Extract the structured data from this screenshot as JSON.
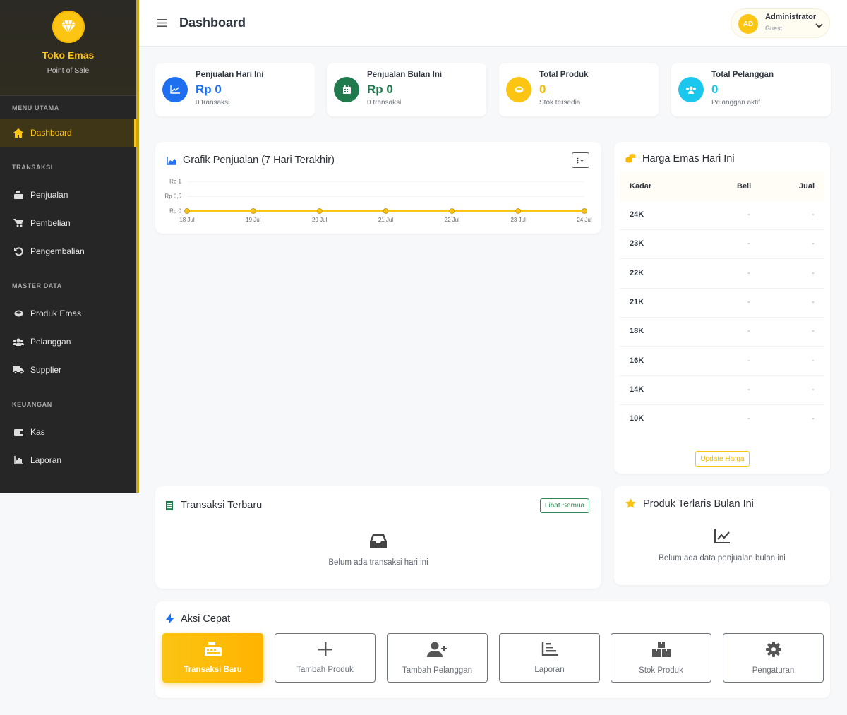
{
  "sidebar": {
    "brand": {
      "title": "Toko Emas",
      "subtitle": "Point of Sale"
    },
    "sections": {
      "main": "MENU UTAMA",
      "transaksi": "TRANSAKSI",
      "master": "MASTER DATA",
      "keuangan": "KEUANGAN"
    },
    "items": {
      "dashboard": "Dashboard",
      "penjualan": "Penjualan",
      "pembelian": "Pembelian",
      "pengembalian": "Pengembalian",
      "produk": "Produk Emas",
      "pelanggan": "Pelanggan",
      "supplier": "Supplier",
      "kas": "Kas",
      "laporan": "Laporan"
    }
  },
  "header": {
    "title": "Dashboard",
    "user": {
      "initials": "AD",
      "name": "Administrator",
      "role": "Guest"
    }
  },
  "stats": [
    {
      "title": "Penjualan Hari Ini",
      "value": "Rp 0",
      "sub": "0 transaksi",
      "color": "#1e6ff0"
    },
    {
      "title": "Penjualan Bulan Ini",
      "value": "Rp 0",
      "sub": "0 transaksi",
      "color": "#1f7a4d"
    },
    {
      "title": "Total Produk",
      "value": "0",
      "sub": "Stok tersedia",
      "color": "#fcc413"
    },
    {
      "title": "Total Pelanggan",
      "value": "0",
      "sub": "Pelanggan aktif",
      "color": "#1cc7ee"
    }
  ],
  "sales_chart": {
    "title": "Grafik Penjualan (7 Hari Terakhir)"
  },
  "chart_data": {
    "type": "line",
    "categories": [
      "18 Jul",
      "19 Jul",
      "20 Jul",
      "21 Jul",
      "22 Jul",
      "23 Jul",
      "24 Jul"
    ],
    "values": [
      0,
      0,
      0,
      0,
      0,
      0,
      0
    ],
    "y_ticks": [
      "Rp 0",
      "Rp 0,5",
      "Rp 1"
    ],
    "ylim": [
      0,
      1
    ],
    "grid": true,
    "color": "#fcc413"
  },
  "gold": {
    "title": "Harga Emas Hari Ini",
    "headers": {
      "kadar": "Kadar",
      "beli": "Beli",
      "jual": "Jual"
    },
    "rows": [
      {
        "kadar": "24K",
        "beli": "-",
        "jual": "-"
      },
      {
        "kadar": "23K",
        "beli": "-",
        "jual": "-"
      },
      {
        "kadar": "22K",
        "beli": "-",
        "jual": "-"
      },
      {
        "kadar": "21K",
        "beli": "-",
        "jual": "-"
      },
      {
        "kadar": "18K",
        "beli": "-",
        "jual": "-"
      },
      {
        "kadar": "16K",
        "beli": "-",
        "jual": "-"
      },
      {
        "kadar": "14K",
        "beli": "-",
        "jual": "-"
      },
      {
        "kadar": "10K",
        "beli": "-",
        "jual": "-"
      }
    ],
    "update_label": "Update Harga"
  },
  "recent": {
    "title": "Transaksi Terbaru",
    "view_all": "Lihat Semua",
    "empty": "Belum ada transaksi hari ini"
  },
  "bestseller": {
    "title": "Produk Terlaris Bulan Ini",
    "empty": "Belum ada data penjualan bulan ini"
  },
  "quick": {
    "title": "Aksi Cepat",
    "actions": [
      {
        "label": "Transaksi Baru",
        "icon": "cash-register-icon"
      },
      {
        "label": "Tambah Produk",
        "icon": "plus-icon"
      },
      {
        "label": "Tambah Pelanggan",
        "icon": "user-plus-icon"
      },
      {
        "label": "Laporan",
        "icon": "chart-icon"
      },
      {
        "label": "Stok Produk",
        "icon": "boxes-icon"
      },
      {
        "label": "Pengaturan",
        "icon": "gear-icon"
      }
    ]
  }
}
